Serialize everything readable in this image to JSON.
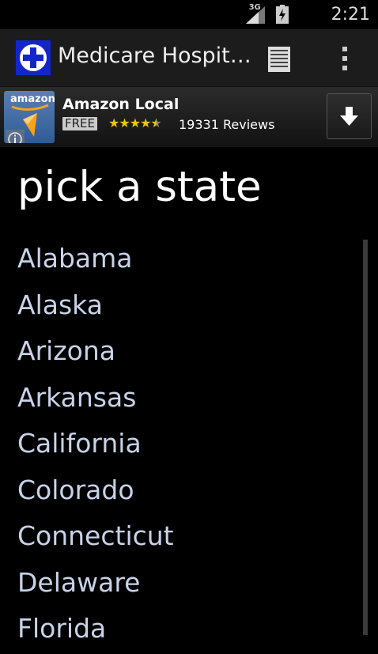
{
  "status_bar": {
    "network": "3G",
    "time": "2:21"
  },
  "action_bar": {
    "title": "Medicare Hospit…"
  },
  "ad": {
    "logo_text": "amazon",
    "title": "Amazon Local",
    "price": "FREE",
    "rating": 4.5,
    "stars": "★★★★★",
    "reviews": "19331 Reviews"
  },
  "content": {
    "heading": "pick a state",
    "states": [
      "Alabama",
      "Alaska",
      "Arizona",
      "Arkansas",
      "California",
      "Colorado",
      "Connecticut",
      "Delaware",
      "Florida"
    ]
  },
  "colors": {
    "background": "#000000",
    "action_bar": "#1c1c1c",
    "list_text": "#c8d2e8",
    "star": "#f2c40a"
  }
}
